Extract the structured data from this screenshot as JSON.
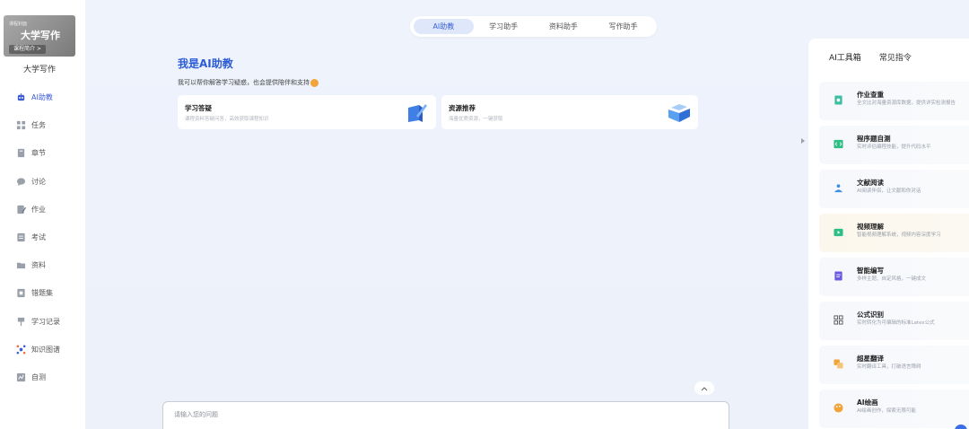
{
  "sidebar": {
    "cover": {
      "tiny": "课程封面",
      "big": "大学写作",
      "bar": "课程简介 >"
    },
    "course_name": "大学写作",
    "items": [
      {
        "label": "AI助教",
        "icon": "robot-icon",
        "active": true
      },
      {
        "label": "任务",
        "icon": "grid-icon"
      },
      {
        "label": "章节",
        "icon": "book-icon"
      },
      {
        "label": "讨论",
        "icon": "chat-bubble-icon"
      },
      {
        "label": "作业",
        "icon": "pencil-doc-icon"
      },
      {
        "label": "考试",
        "icon": "exam-doc-icon"
      },
      {
        "label": "资料",
        "icon": "folder-icon"
      },
      {
        "label": "错题集",
        "icon": "error-book-icon"
      },
      {
        "label": "学习记录",
        "icon": "record-icon"
      },
      {
        "label": "知识图谱",
        "icon": "graph-icon"
      },
      {
        "label": "自测",
        "icon": "chart-icon"
      }
    ]
  },
  "top_tabs": [
    {
      "label": "AI助教",
      "active": true
    },
    {
      "label": "学习助手"
    },
    {
      "label": "资料助手"
    },
    {
      "label": "写作助手"
    }
  ],
  "main": {
    "title": "我是AI助教",
    "subtitle": "我可以帮你解答学习疑惑，也会提供陪伴和支持",
    "cards": [
      {
        "title": "学习答疑",
        "desc": "课程资料答疑问答，高效获取课程知识",
        "icon": "pen-book-icon"
      },
      {
        "title": "资源推荐",
        "desc": "海量优质资源，一键获取",
        "icon": "open-book-icon"
      }
    ],
    "input_placeholder": "请输入您的问题"
  },
  "right_panel": {
    "tabs": [
      {
        "label": "AI工具箱",
        "active": true
      },
      {
        "label": "常见指令"
      }
    ],
    "tools": [
      {
        "title": "作业查重",
        "desc": "全文比对海量资源库数据，提供详实检测报告",
        "icon": "check-doc-icon",
        "color": "#3cc0a0"
      },
      {
        "title": "程序题自测",
        "desc": "实时评估编程技能，提升代码水平",
        "icon": "code-icon",
        "color": "#2fbf86"
      },
      {
        "title": "文献阅读",
        "desc": "AI阅读伴侣，让文献和你对话",
        "icon": "reader-icon",
        "color": "#3a8de0"
      },
      {
        "title": "视频理解",
        "desc": "智能视频理解系统，视频内容深度学习",
        "icon": "video-icon",
        "color": "#2fbf86"
      },
      {
        "title": "智能编写",
        "desc": "多样主题、自定风格，一键成文",
        "icon": "write-icon",
        "color": "#6c5be0"
      },
      {
        "title": "公式识别",
        "desc": "实时转化为可编辑的标准Latex公式",
        "icon": "formula-icon",
        "color": "#555"
      },
      {
        "title": "超星翻译",
        "desc": "实时翻译工具，打破语言障碍",
        "icon": "translate-icon",
        "color": "#f2a33a"
      },
      {
        "title": "AI绘画",
        "desc": "AI绘画创作，探索无限可能",
        "icon": "palette-icon",
        "color": "#f2a33a"
      }
    ]
  }
}
